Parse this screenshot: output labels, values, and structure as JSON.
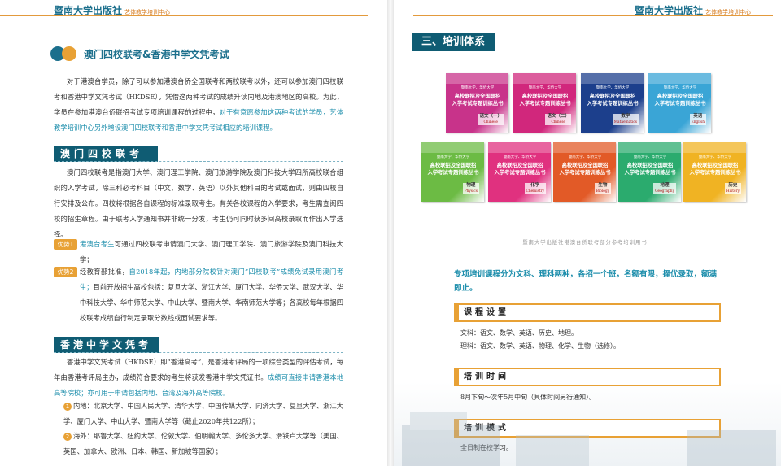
{
  "left": {
    "header": {
      "brand": "暨南大学出版社",
      "sub": "艺体教学培训中心"
    },
    "title": "澳门四校联考&香港中学文凭考试",
    "intro": {
      "before": "对于港澳台学员，除了可以参加港澳台侨全国联考和两校联考以外，还可以参加澳门四校联考和香港中学文凭考试（HKDSE），凭借这两种考试的成绩升读内地及港澳地区的高校。为此，学员在参加港澳台侨联招考试专项培训课程的过程中，",
      "highlight": "对于有意愿参加这两种考试的学员，艺体教学培训中心另外增设澳门四校联考和香港中学文凭考试相应的培训课程。"
    },
    "macau": {
      "heading": "澳门四校联考",
      "body": "澳门四校联考是指澳门大学、澳门理工学院、澳门旅游学院及澳门科技大学四所高校联合组织的入学考试，除三科必考科目（中文、数学、英语）以外其他科目的考试或面试，则由四校自行安排及公布。四校将根据各自课程的标准录取考生。有关各校课程的入学要求，考生需查阅四校的招生章程。由于联考入学通知书并非统一分发，考生仍可同时获多间高校录取而作出入学选择。",
      "adv1_label": "优势1",
      "adv1_text": "港澳台考生可通过四校联考申请澳门大学、澳门理工学院、澳门旅游学院及澳门科技大学；",
      "adv1_hl": "港澳台考生",
      "adv1_rest": "可通过四校联考申请澳门大学、澳门理工学院、澳门旅游学院及澳门科技大学；",
      "adv2_label": "优势2",
      "adv2_before": "经教育部批准，",
      "adv2_hl": "自2018年起，内地部分院校针对澳门“四校联考”成绩免试录用澳门考生；",
      "adv2_after": "目前开放招生高校包括：复旦大学、浙江大学、厦门大学、华侨大学、武汉大学、华中科技大学、华中师范大学、中山大学、暨南大学、华南师范大学等；各高校每年根据四校联考成绩自行制定录取分数线或面试要求等。"
    },
    "hk": {
      "heading": "香港中学文凭考试",
      "body": "香港中学文凭考试（HKDSE）即“香港高考”，是香港考评局的一项综合类型的评估考试，每年由香港考评局主办，成绩符合要求的考生将获发香港中学文凭证书。",
      "body_hl": "成绩可直接申请香港本地高等院校；亦可用于申请包括内地、台湾及海外高等院校。",
      "item1_num": "1",
      "item1": "内地：北京大学、中国人民大学、清华大学、中国传媒大学、同济大学、复旦大学、浙江大学、厦门大学、中山大学、暨南大学等（截止2020年共122所）；",
      "item2_num": "2",
      "item2": "海外：耶鲁大学、纽约大学、伦敦大学、伯明翰大学、多伦多大学、滑铁卢大学等（美国、英国、加拿大、欧洲、日本、韩国、新加坡等国家）；"
    }
  },
  "right": {
    "header": {
      "brand": "暨南大学出版社",
      "sub": "艺体教学培训中心"
    },
    "section_title": "三、培训体系",
    "book_series": "入学考试专题训练丛书",
    "book_top": "暨南大学、华侨大学",
    "book_mid": "高校联招及全国联招",
    "books": [
      {
        "subject": "语文（一）",
        "en": "Chinese",
        "color": "#c8338a"
      },
      {
        "subject": "语文（二）",
        "en": "Chinese",
        "color": "#d1277c"
      },
      {
        "subject": "数学",
        "en": "Mathematics",
        "color": "#1c3f8c"
      },
      {
        "subject": "英语",
        "en": "English",
        "color": "#3aa5d6"
      },
      {
        "subject": "物理",
        "en": "Physics",
        "color": "#6cbb44"
      },
      {
        "subject": "化学",
        "en": "Chemistry",
        "color": "#e0317f"
      },
      {
        "subject": "生物",
        "en": "Biology",
        "color": "#e25a27"
      },
      {
        "subject": "地理",
        "en": "Geography",
        "color": "#2bab6e"
      },
      {
        "subject": "历史",
        "en": "History",
        "color": "#f0b323"
      }
    ],
    "caption": "暨南大学出版社港澳台侨联考部分参考培训用书",
    "intro": "专项培训课程分为文科、理科两种，各招一个班，名额有限，择优录取，额满即止。",
    "course": {
      "heading": "课程设置",
      "line1": "文科：语文、数学、英语、历史、地理。",
      "line2": "理科：语文、数学、英语、物理、化学、生物（选修）。"
    },
    "time": {
      "heading": "培训时间",
      "line1": "8月下旬～次年5月中旬（具体时间另行通知）。"
    },
    "mode": {
      "heading": "培训模式",
      "line1": "全日制在校学习。"
    }
  }
}
